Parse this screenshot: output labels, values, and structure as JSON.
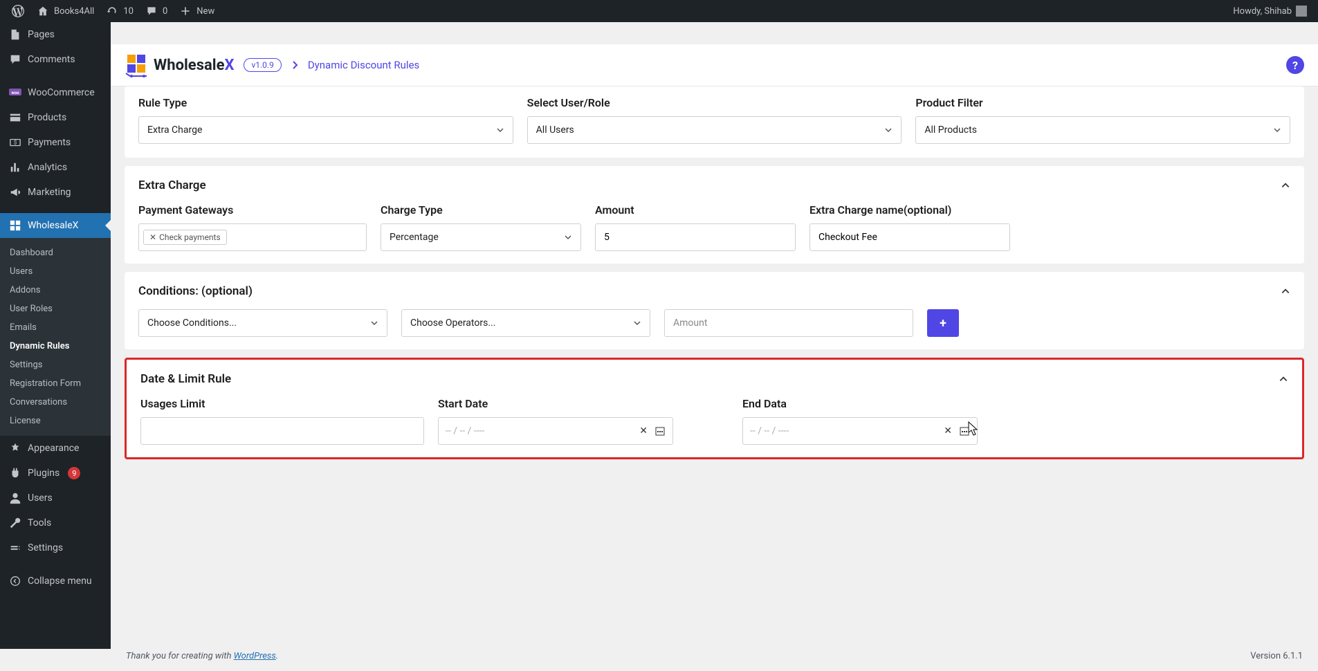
{
  "adminbar": {
    "site_name": "Books4All",
    "updates": "10",
    "comments": "0",
    "new": "New",
    "howdy": "Howdy, Shihab"
  },
  "sidebar": {
    "items": [
      {
        "label": "Pages"
      },
      {
        "label": "Comments"
      },
      {
        "label": "WooCommerce"
      },
      {
        "label": "Products"
      },
      {
        "label": "Payments"
      },
      {
        "label": "Analytics"
      },
      {
        "label": "Marketing"
      },
      {
        "label": "WholesaleX"
      },
      {
        "label": "Appearance"
      },
      {
        "label": "Plugins"
      },
      {
        "label": "Users"
      },
      {
        "label": "Tools"
      },
      {
        "label": "Settings"
      },
      {
        "label": "Collapse menu"
      }
    ],
    "plugins_badge": "9",
    "submenu": [
      {
        "label": "Dashboard"
      },
      {
        "label": "Users"
      },
      {
        "label": "Addons"
      },
      {
        "label": "User Roles"
      },
      {
        "label": "Emails"
      },
      {
        "label": "Dynamic Rules"
      },
      {
        "label": "Settings"
      },
      {
        "label": "Registration Form"
      },
      {
        "label": "Conversations"
      },
      {
        "label": "License"
      }
    ]
  },
  "header": {
    "logo_text_a": "Wholesale",
    "logo_text_b": "X",
    "version": "v1.0.9",
    "breadcrumb": "Dynamic Discount Rules"
  },
  "top_row": {
    "rule_type": {
      "label": "Rule Type",
      "value": "Extra Charge"
    },
    "user_role": {
      "label": "Select User/Role",
      "value": "All Users"
    },
    "product_filter": {
      "label": "Product Filter",
      "value": "All Products"
    }
  },
  "extra_charge": {
    "title": "Extra Charge",
    "gateways": {
      "label": "Payment Gateways",
      "tag": "Check payments"
    },
    "charge_type": {
      "label": "Charge Type",
      "value": "Percentage"
    },
    "amount": {
      "label": "Amount",
      "value": "5"
    },
    "name": {
      "label": "Extra Charge name(optional)",
      "value": "Checkout Fee"
    }
  },
  "conditions": {
    "title": "Conditions: (optional)",
    "choose_cond": "Choose Conditions...",
    "choose_op": "Choose Operators...",
    "amount_placeholder": "Amount"
  },
  "date_limit": {
    "title": "Date & Limit Rule",
    "usages": {
      "label": "Usages Limit"
    },
    "start": {
      "label": "Start Date",
      "placeholder": "--  /  --  /  ----"
    },
    "end": {
      "label": "End Data",
      "placeholder": "--  /  --  /  ----"
    }
  },
  "footer": {
    "thanks_a": "Thank you for creating with ",
    "thanks_link": "WordPress",
    "thanks_b": ".",
    "version": "Version 6.1.1"
  }
}
